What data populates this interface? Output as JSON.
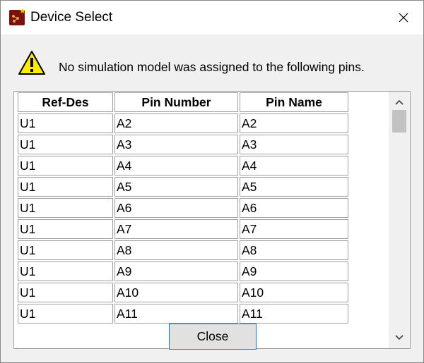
{
  "window": {
    "title": "Device Select"
  },
  "message": "No simulation model was assigned to the following pins.",
  "table": {
    "headers": [
      "Ref-Des",
      "Pin Number",
      "Pin Name"
    ],
    "rows": [
      [
        "U1",
        "A2",
        "A2"
      ],
      [
        "U1",
        "A3",
        "A3"
      ],
      [
        "U1",
        "A4",
        "A4"
      ],
      [
        "U1",
        "A5",
        "A5"
      ],
      [
        "U1",
        "A6",
        "A6"
      ],
      [
        "U1",
        "A7",
        "A7"
      ],
      [
        "U1",
        "A8",
        "A8"
      ],
      [
        "U1",
        "A9",
        "A9"
      ],
      [
        "U1",
        "A10",
        "A10"
      ],
      [
        "U1",
        "A11",
        "A11"
      ]
    ]
  },
  "buttons": {
    "close_label": "Close"
  },
  "colors": {
    "accent": "#0078d7",
    "warning": "#ffeb00"
  }
}
